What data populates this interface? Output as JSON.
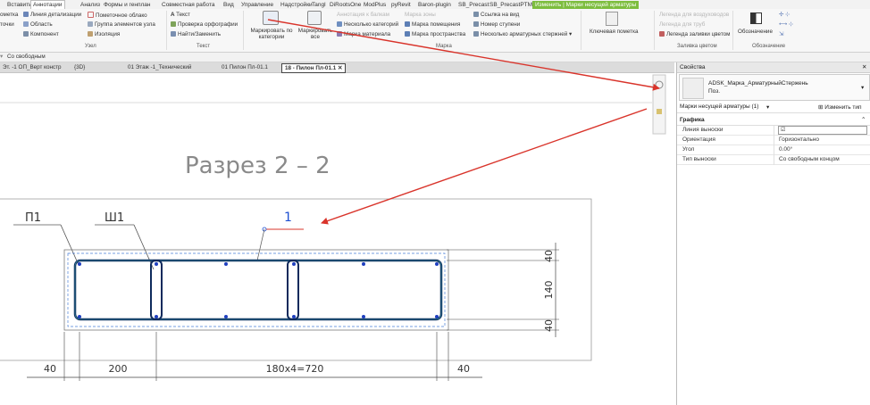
{
  "ribbon_tabs": [
    "Вставить",
    "Аннотации",
    "Анализ",
    "Формы и генплан",
    "Совместная работа",
    "Вид",
    "Управление",
    "Надстройки",
    "Tangl",
    "DiRootsOne",
    "ModPlus",
    "pyRevit",
    "Baron-plugin",
    "SB_Precast",
    "SB_PrecastPTM",
    "Изменить | Марки несущей арматуры"
  ],
  "ribbon": {
    "c0": [
      "ометка",
      "точки"
    ],
    "detail": [
      "Линия детализации",
      "Область",
      "Компонент"
    ],
    "detail2": [
      "Пометочное облако",
      "Группа элементов узла",
      "Изоляция"
    ],
    "panel_node": "Узел",
    "text": [
      "Текст",
      "Проверка орфографии",
      "Найти/Заменить"
    ],
    "panel_text": "Текст",
    "tag_by_category": "Маркировать по категории",
    "tag_all": "Маркировать все",
    "tags_mid": [
      "Аннотация к балкам",
      "Несколько категорий",
      "Марка материала"
    ],
    "tags_mid2": [
      "Марка зоны",
      "Марка помещения",
      "Марка пространства"
    ],
    "tags_right": [
      "Ссылка на вид",
      "Номер ступени",
      "Несколько арматурных стержней"
    ],
    "panel_tag": "Марка",
    "keynote": "Ключевая пометка",
    "legends": [
      "Легенда для воздуховодов",
      "Легенда для труб",
      "Легенда заливки цветом"
    ],
    "panel_fill": "Заливка цветом",
    "symbol": "Обозначение",
    "panel_symbol": "Обозначение"
  },
  "modbar": "Со свободным",
  "view_tabs": [
    "Эт. -1 ОП_Верт констр",
    "{3D}",
    "01 Этаж -1_Технический",
    "01 Пилон Пл-01.1",
    "18 - Пилон Пл-01.1"
  ],
  "drawing": {
    "title": "Разрез 2 – 2",
    "label_p1": "П1",
    "label_sh1": "Ш1",
    "tag_value": "1",
    "dim_right": [
      "40",
      "140",
      "40"
    ],
    "dim_bottom": [
      "40",
      "200",
      "180x4=720",
      "40"
    ]
  },
  "properties": {
    "title": "Свойства",
    "type_name": "ADSK_Марка_АрматурныйСтержень",
    "type_sub": "Поз.",
    "selector": "Марки несущей арматуры (1)",
    "edit_type": "Изменить тип",
    "group": "Графика",
    "rows": [
      {
        "key": "Линия выноски",
        "value": "☑"
      },
      {
        "key": "Ориентация",
        "value": "Горизонтально"
      },
      {
        "key": "Угол",
        "value": "0.00°"
      },
      {
        "key": "Тип выноски",
        "value": "Со свободным концом"
      }
    ]
  },
  "colors": {
    "accent_red": "#d9342b",
    "rebar_blue": "#1f3fbf",
    "context_green": "#7dbd3e",
    "tag_blue": "#1d4fd1"
  }
}
